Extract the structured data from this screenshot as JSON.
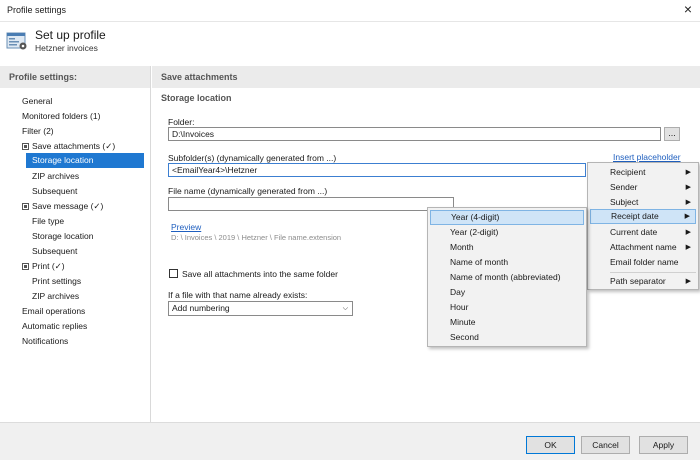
{
  "window": {
    "title": "Profile settings",
    "close_glyph": "×"
  },
  "header": {
    "title": "Set up profile",
    "subtitle": "Hetzner invoices"
  },
  "nav": {
    "heading": "Profile settings:",
    "items": [
      {
        "label": "General"
      },
      {
        "label": "Monitored folders (1)"
      },
      {
        "label": "Filter (2)"
      },
      {
        "label": "Save attachments (✓)"
      },
      {
        "label": "Storage location"
      },
      {
        "label": "ZIP archives"
      },
      {
        "label": "Subsequent"
      },
      {
        "label": "Save message (✓)"
      },
      {
        "label": "File type"
      },
      {
        "label": "Storage location"
      },
      {
        "label": "Subsequent"
      },
      {
        "label": "Print  (✓)"
      },
      {
        "label": "Print settings"
      },
      {
        "label": "ZIP archives"
      },
      {
        "label": "Email operations"
      },
      {
        "label": "Automatic replies"
      },
      {
        "label": "Notifications"
      }
    ]
  },
  "main": {
    "section_title": "Save attachments",
    "subsection_title": "Storage location",
    "folder_label": "Folder:",
    "folder_value": "D:\\Invoices",
    "browse_label": "...",
    "subfolder_label": "Subfolder(s) (dynamically generated from ...)",
    "subfolder_value": "<EmailYear4>\\Hetzner",
    "insert_placeholder": "Insert placeholder",
    "filename_label": "File name (dynamically generated from ...)",
    "filename_value": "",
    "preview_link": "Preview",
    "preview_path": "D: \\ Invoices \\ 2019 \\ Hetzner \\ File name.extension",
    "same_folder_label": "Save all attachments into the same folder",
    "exists_label": "If a file with that name already exists:",
    "exists_value": "Add numbering"
  },
  "placeholder_menu": {
    "items": [
      {
        "label": "Recipient"
      },
      {
        "label": "Sender"
      },
      {
        "label": "Subject"
      },
      {
        "label": "Receipt date"
      },
      {
        "label": "Current date"
      },
      {
        "label": "Attachment name"
      },
      {
        "label": "Email folder name"
      },
      {
        "label": "Path separator"
      }
    ]
  },
  "date_menu": {
    "items": [
      {
        "label": "Year (4-digit)"
      },
      {
        "label": "Year (2-digit)"
      },
      {
        "label": "Month"
      },
      {
        "label": "Name of month"
      },
      {
        "label": "Name of month (abbreviated)"
      },
      {
        "label": "Day"
      },
      {
        "label": "Hour"
      },
      {
        "label": "Minute"
      },
      {
        "label": "Second"
      }
    ]
  },
  "footer": {
    "ok": "OK",
    "cancel": "Cancel",
    "apply": "Apply"
  }
}
